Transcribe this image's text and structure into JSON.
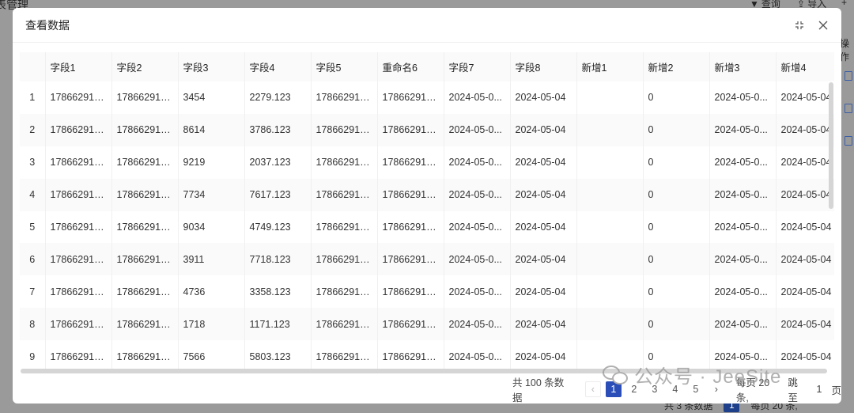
{
  "background": {
    "title": "表管理",
    "query_label": "查询",
    "import_label": "导入",
    "add_label": "+",
    "op_label": "操作",
    "bottom_total": "共 3 条数据",
    "bottom_page": "1",
    "bottom_size": "每页 20 条,"
  },
  "modal": {
    "title": "查看数据",
    "fullscreen_icon": "fullscreen-icon",
    "close_icon": "close-icon"
  },
  "table": {
    "columns": [
      "",
      "字段1",
      "字段2",
      "字段3",
      "字段4",
      "字段5",
      "重命名6",
      "字段7",
      "字段8",
      "新增1",
      "新增2",
      "新增3",
      "新增4"
    ],
    "rows": [
      [
        "1",
        "178662910...",
        "178662910...",
        "3454",
        "2279.123",
        "178662910...",
        "178662910...",
        "2024-05-0...",
        "2024-05-04",
        "",
        "0",
        "2024-05-0...",
        "2024-05-04"
      ],
      [
        "2",
        "178662910...",
        "178662910...",
        "8614",
        "3786.123",
        "178662910...",
        "178662910...",
        "2024-05-0...",
        "2024-05-04",
        "",
        "0",
        "2024-05-0...",
        "2024-05-04"
      ],
      [
        "3",
        "178662910...",
        "178662910...",
        "9219",
        "2037.123",
        "178662910...",
        "178662910...",
        "2024-05-0...",
        "2024-05-04",
        "",
        "0",
        "2024-05-0...",
        "2024-05-04"
      ],
      [
        "4",
        "178662910...",
        "178662910...",
        "7734",
        "7617.123",
        "178662910...",
        "178662910...",
        "2024-05-0...",
        "2024-05-04",
        "",
        "0",
        "2024-05-0...",
        "2024-05-04"
      ],
      [
        "5",
        "178662910...",
        "178662910...",
        "9034",
        "4749.123",
        "178662910...",
        "178662910...",
        "2024-05-0...",
        "2024-05-04",
        "",
        "0",
        "2024-05-0...",
        "2024-05-04"
      ],
      [
        "6",
        "178662910...",
        "178662910...",
        "3911",
        "7718.123",
        "178662910...",
        "178662910...",
        "2024-05-0...",
        "2024-05-04",
        "",
        "0",
        "2024-05-0...",
        "2024-05-04"
      ],
      [
        "7",
        "178662910...",
        "178662910...",
        "4736",
        "3358.123",
        "178662910...",
        "178662910...",
        "2024-05-0...",
        "2024-05-04",
        "",
        "0",
        "2024-05-0...",
        "2024-05-04"
      ],
      [
        "8",
        "178662910...",
        "178662910...",
        "1718",
        "1171.123",
        "178662910...",
        "178662910...",
        "2024-05-0...",
        "2024-05-04",
        "",
        "0",
        "2024-05-0...",
        "2024-05-04"
      ],
      [
        "9",
        "178662910...",
        "178662910...",
        "7566",
        "5803.123",
        "178662910...",
        "178662910...",
        "2024-05-0...",
        "2024-05-04",
        "",
        "0",
        "2024-05-0...",
        "2024-05-04"
      ]
    ]
  },
  "pagination": {
    "total": "共 100 条数据",
    "pages": [
      "1",
      "2",
      "3",
      "4",
      "5"
    ],
    "active": "1",
    "size": "每页 20 条,",
    "jump_label": "跳至",
    "jump_value": "1",
    "page_suffix": "页"
  },
  "watermark": {
    "text": "公众号 · JeeSite"
  }
}
